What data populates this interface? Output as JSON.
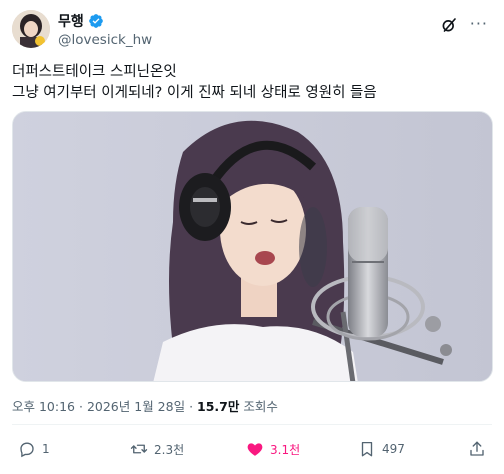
{
  "author": {
    "display_name": "무행",
    "handle": "@lovesick_hw",
    "verified": true
  },
  "tweet": {
    "line1": "더퍼스트테이크 스피닌온잇",
    "line2": "그냥 여기부터 이게되네? 이게 진짜 되네 상태로 영원히 들음"
  },
  "meta": {
    "time": "오후 10:16",
    "separator1": "·",
    "date": "2026년 1월 28일",
    "separator2": "·",
    "views_count": "15.7만",
    "views_label": "조회수"
  },
  "actions": {
    "replies": "1",
    "reposts": "2.3천",
    "likes": "3.1천",
    "bookmarks": "497"
  },
  "colors": {
    "verified_blue": "#1d9bf0",
    "like_pink": "#f91880",
    "secondary_text": "#536471"
  },
  "icons": [
    "verified-badge-icon",
    "grok-icon",
    "more-icon",
    "reply-icon",
    "repost-icon",
    "like-icon",
    "bookmark-icon",
    "share-icon"
  ]
}
